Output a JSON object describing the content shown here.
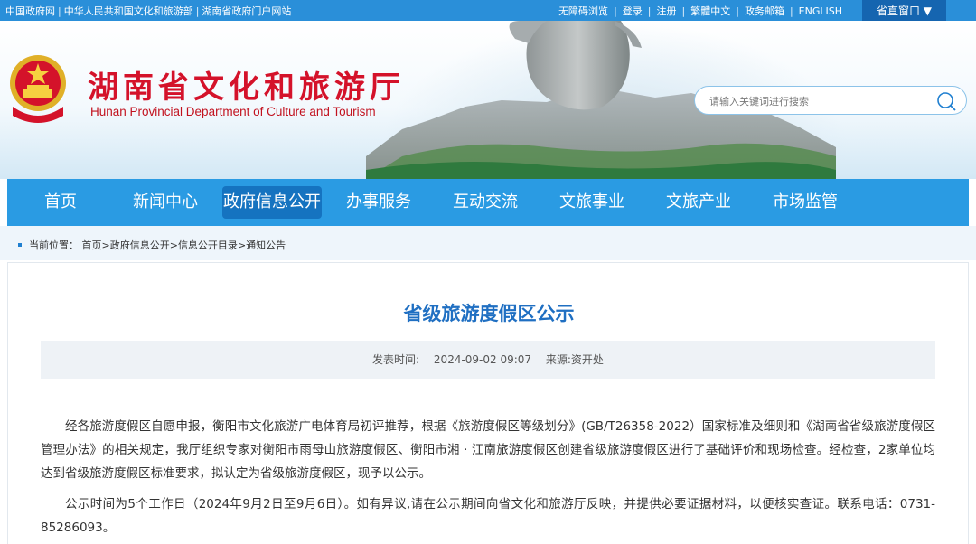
{
  "topbar": {
    "links_left": [
      "中国政府网",
      "中华人民共和国文化和旅游部",
      "湖南省政府门户网站"
    ],
    "links_right": [
      "无障碍浏览",
      "登录",
      "注册",
      "繁體中文",
      "政务邮箱",
      "ENGLISH"
    ],
    "province_window": "省直窗口 ▼"
  },
  "header": {
    "title_cn": "湖南省文化和旅游厅",
    "title_en": "Hunan Provincial Department of Culture and Tourism",
    "search_placeholder": "请输入关键词进行搜索"
  },
  "nav": {
    "items": [
      "首页",
      "新闻中心",
      "政府信息公开",
      "办事服务",
      "互动交流",
      "文旅事业",
      "文旅产业",
      "市场监管"
    ],
    "active_index": 2
  },
  "breadcrumb": {
    "label": "当前位置：",
    "path": [
      "首页",
      "政府信息公开",
      "信息公开目录",
      "通知公告"
    ]
  },
  "article": {
    "title": "省级旅游度假区公示",
    "publish_label": "发表时间:",
    "publish_time": "2024-09-02 09:07",
    "source": "来源:资开处",
    "paragraphs": [
      "经各旅游度假区自愿申报，衡阳市文化旅游广电体育局初评推荐，根据《旅游度假区等级划分》(GB/T26358-2022）国家标准及细则和《湖南省省级旅游度假区管理办法》的相关规定，我厅组织专家对衡阳市雨母山旅游度假区、衡阳市湘 · 江南旅游度假区创建省级旅游度假区进行了基础评价和现场检查。经检查，2家单位均达到省级旅游度假区标准要求，拟认定为省级旅游度假区，现予以公示。",
      "公示时间为5个工作日（2024年9月2日至9月6日）。如有异议,请在公示期间向省文化和旅游厅反映，并提供必要证据材料，以便核实查证。联系电话：0731-85286093。"
    ]
  },
  "colors": {
    "topbar": "#2a8fd9",
    "nav": "#2a9be3",
    "nav_active": "#1573c0",
    "title_red": "#d4122a",
    "article_title": "#1f6fc2"
  }
}
